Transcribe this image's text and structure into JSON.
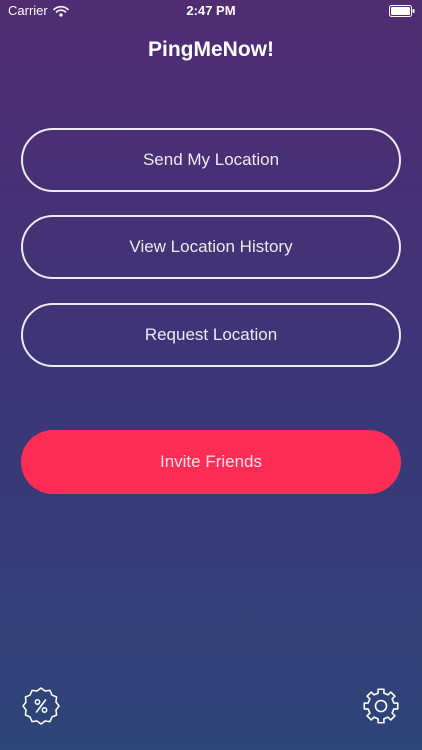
{
  "status_bar": {
    "carrier": "Carrier",
    "time": "2:47 PM",
    "wifi_icon": "wifi-icon",
    "battery_icon": "battery-icon"
  },
  "app": {
    "title": "PingMeNow!"
  },
  "actions": {
    "send_location": "Send My Location",
    "view_history": "View Location History",
    "request_location": "Request Location",
    "invite_friends": "Invite Friends"
  },
  "footer": {
    "left_icon": "discount-badge-icon",
    "right_icon": "gear-icon"
  },
  "colors": {
    "background_top": "#512c73",
    "background_bottom": "#2d4579",
    "accent": "#ff2d55",
    "text": "#ffffff"
  }
}
